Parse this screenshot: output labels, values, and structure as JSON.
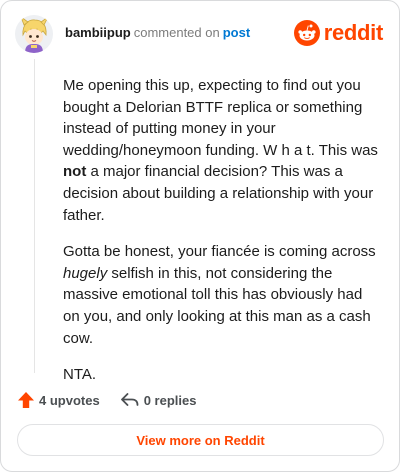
{
  "comment": {
    "username": "bambiipup",
    "verb": "commented on",
    "post_link": "post",
    "brand": "reddit",
    "avatar_icon": "cartoon-avatar-icon",
    "body": {
      "p1": "Me opening this up, expecting to find out you bought a Delorian BTTF replica or something instead of putting money in your wedding/honeymoon funding. W h a t. This was ",
      "p1_bold": "not",
      "p1_tail": " a major financial decision? This was a decision about building a relationship with your father.",
      "p2_head": "Gotta be honest, your fiancée is coming across ",
      "p2_italic": "hugely",
      "p2_tail": " selfish in this, not considering the massive emotional toll this has obviously had on you, and only looking at this man as a cash cow.",
      "p3": "NTA."
    }
  },
  "actions": {
    "upvotes": "4 upvotes",
    "replies": "0 replies",
    "upvote_icon": "upvote-arrow-icon",
    "reply_icon": "reply-arrow-icon"
  },
  "view_more": "View more on Reddit",
  "colors": {
    "brand": "#ff4500",
    "link": "#0079d3",
    "text": "#1c1c1c",
    "muted": "#7c7c7c"
  }
}
